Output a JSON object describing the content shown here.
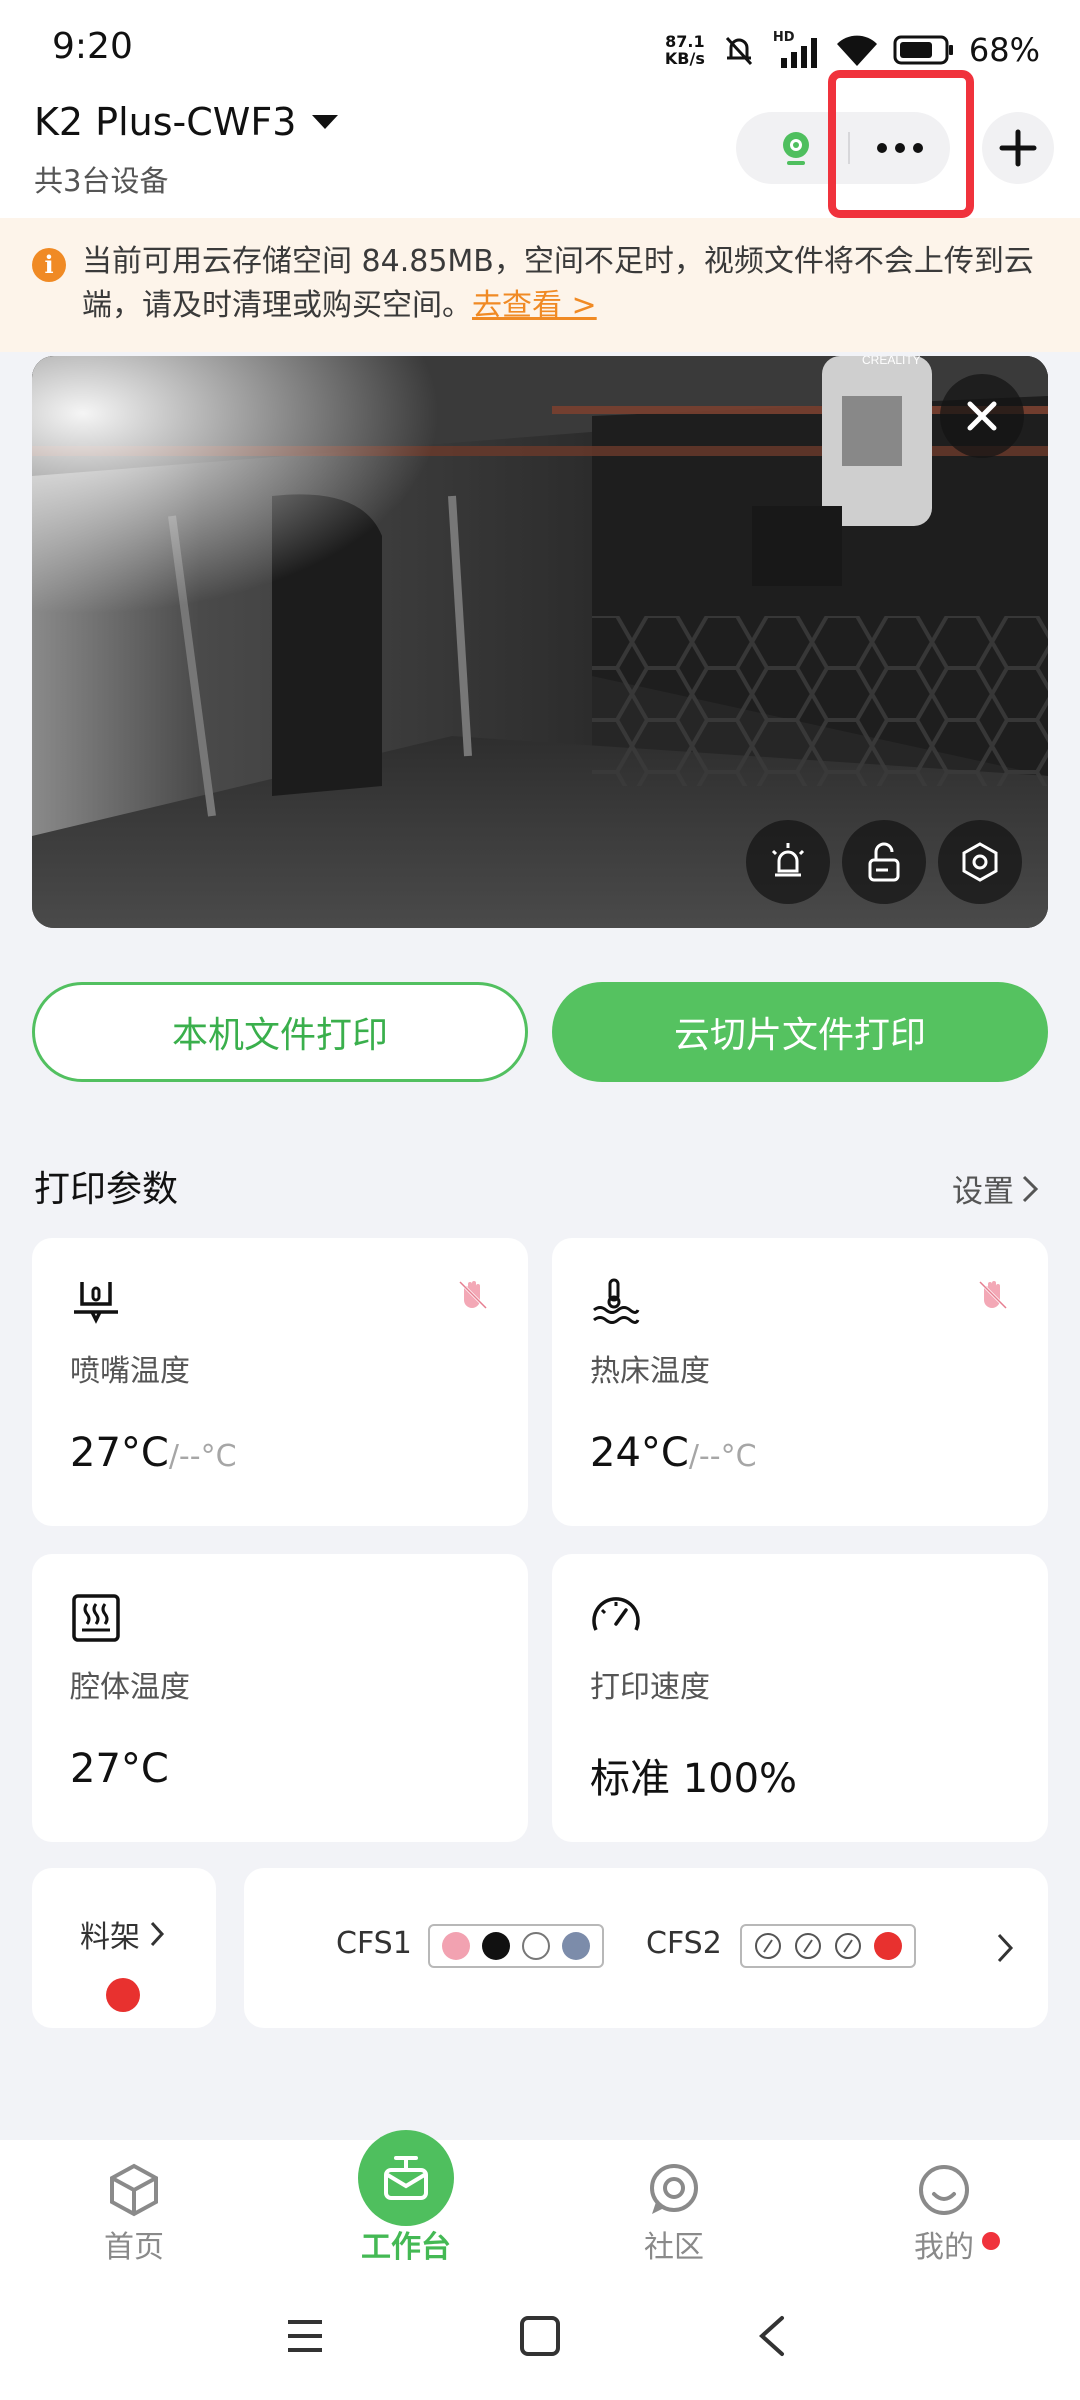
{
  "status_bar": {
    "time": "9:20",
    "net_speed_value": "87.1",
    "net_speed_unit": "KB/s",
    "hd_label": "HD",
    "battery": "68%"
  },
  "header": {
    "device_name": "K2 Plus-CWF3",
    "device_count": "共3台设备"
  },
  "notice": {
    "text": "当前可用云存储空间 84.85MB，空间不足时，视频文件将不会上传到云端，请及时清理或购买空间。",
    "link": "去查看 >"
  },
  "camera": {
    "brand_watermark": "CREALITY"
  },
  "buttons": {
    "local_print": "本机文件打印",
    "cloud_print": "云切片文件打印"
  },
  "params": {
    "title": "打印参数",
    "settings": "设置",
    "nozzle": {
      "label": "喷嘴温度",
      "value": "27°C",
      "target": "/--°C"
    },
    "bed": {
      "label": "热床温度",
      "value": "24°C",
      "target": "/--°C"
    },
    "chamber": {
      "label": "腔体温度",
      "value": "27°C"
    },
    "speed": {
      "label": "打印速度",
      "value": "标准 100%"
    }
  },
  "material": {
    "rack_label": "料架",
    "rack_color": "#e8312f",
    "cfs1_label": "CFS1",
    "cfs1_slots": [
      "#f2a2b1",
      "#111111",
      "#ffffff",
      "#7c8caa"
    ],
    "cfs2_label": "CFS2",
    "cfs2_slots": [
      "empty",
      "empty",
      "empty",
      "#e8312f"
    ]
  },
  "nav": {
    "home": "首页",
    "workbench": "工作台",
    "community": "社区",
    "mine": "我的"
  },
  "colors": {
    "accent_green": "#55c260",
    "warning_orange": "#f08a24",
    "highlight_red": "#f0323c"
  }
}
